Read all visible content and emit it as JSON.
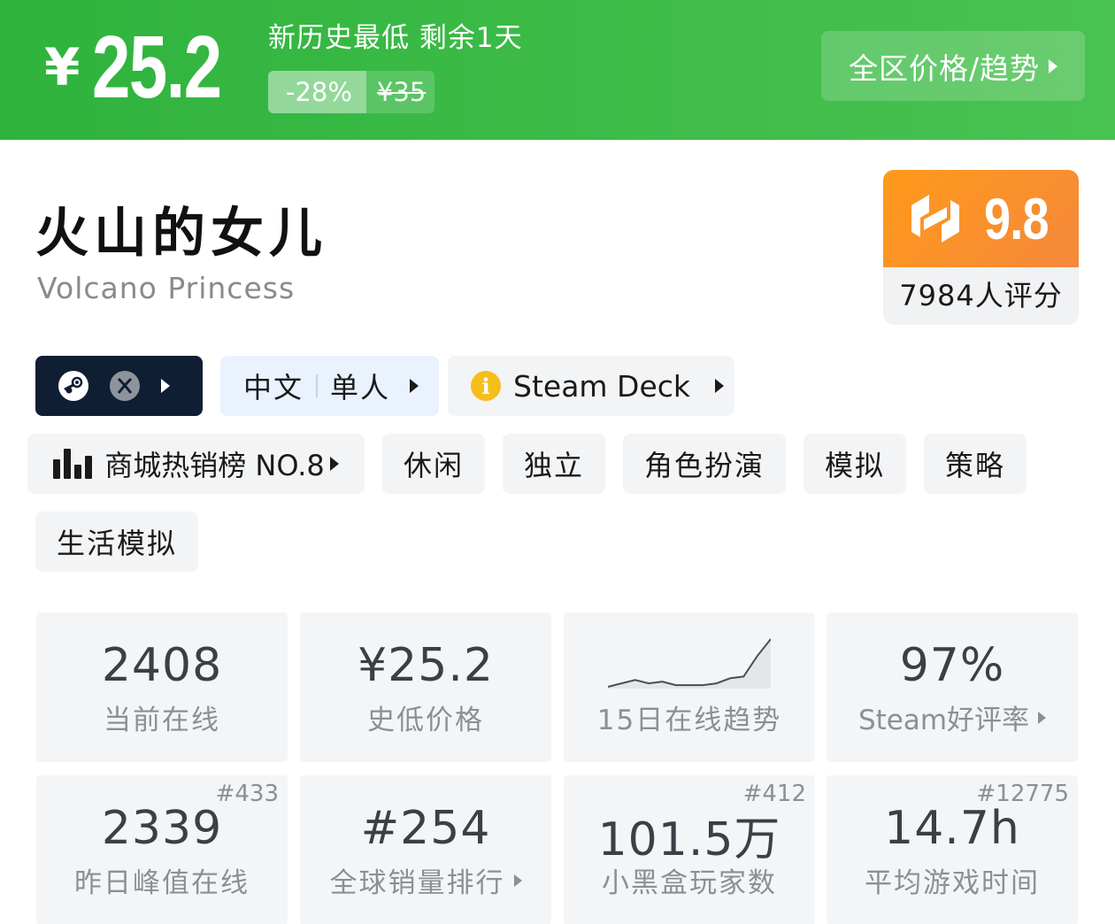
{
  "banner": {
    "currency": "¥",
    "price": "25.2",
    "status": "新历史最低 剩余1天",
    "discount": "-28%",
    "original_price": "¥35",
    "trend_button": "全区价格/趋势"
  },
  "game": {
    "title": "火山的女儿",
    "subtitle": "Volcano Princess"
  },
  "score": {
    "value": "9.8",
    "count_label": "7984人评分",
    "color": "#ff9a1a"
  },
  "platform_chip": {
    "icons": [
      "steam-icon",
      "xbox-icon"
    ]
  },
  "language_chip": {
    "language": "中文",
    "mode": "单人"
  },
  "deck_chip": {
    "icon": "info-icon",
    "label": "Steam Deck"
  },
  "tags": {
    "ranking": "商城热销榜 NO.8",
    "items": [
      "休闲",
      "独立",
      "角色扮演",
      "模拟",
      "策略",
      "生活模拟"
    ]
  },
  "stats": [
    {
      "value": "2408",
      "label": "当前在线"
    },
    {
      "value": "¥25.2",
      "label": "史低价格"
    },
    {
      "label": "15日在线趋势",
      "trend": [
        2,
        4,
        6,
        4,
        5,
        3,
        3,
        3,
        4,
        7,
        8,
        20,
        30
      ]
    },
    {
      "value": "97%",
      "label": "Steam好评率"
    },
    {
      "value": "2339",
      "label": "昨日峰值在线",
      "rank": "#433"
    },
    {
      "value": "#254",
      "label": "全球销量排行"
    },
    {
      "value": "101.5万",
      "label": "小黑盒玩家数",
      "rank": "#412"
    },
    {
      "value": "14.7h",
      "label": "平均游戏时间",
      "rank": "#12775"
    }
  ]
}
